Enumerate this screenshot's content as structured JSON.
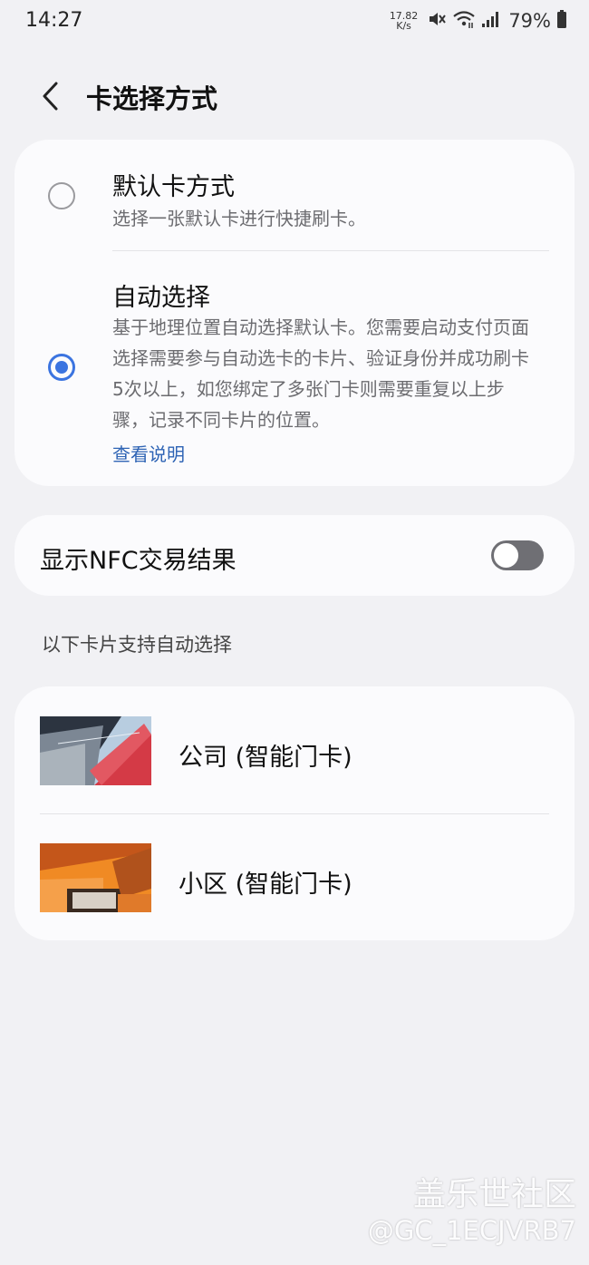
{
  "status_bar": {
    "time": "14:27",
    "net_speed_value": "17.82",
    "net_speed_unit": "K/s",
    "battery": "79%"
  },
  "header": {
    "title": "卡选择方式"
  },
  "selection_modes": {
    "options": [
      {
        "title": "默认卡方式",
        "description": "选择一张默认卡进行快捷刷卡。",
        "selected": false
      },
      {
        "title": "自动选择",
        "description": "基于地理位置自动选择默认卡。您需要启动支付页面选择需要参与自动选卡的卡片、验证身份并成功刷卡5次以上，如您绑定了多张门卡则需要重复以上步骤，记录不同卡片的位置。",
        "link": "查看说明",
        "selected": true
      }
    ]
  },
  "nfc": {
    "label": "显示NFC交易结果",
    "enabled": false
  },
  "supported_cards": {
    "header": "以下卡片支持自动选择",
    "items": [
      {
        "label": "公司 (智能门卡)"
      },
      {
        "label": "小区 (智能门卡)"
      }
    ]
  },
  "watermark": {
    "line1": "盖乐世社区",
    "line2": "@GC_1ECJVRB7"
  },
  "colors": {
    "accent": "#3b74e0",
    "link": "#2f64b5",
    "background": "#f1f1f4",
    "card": "#fbfbfd"
  }
}
